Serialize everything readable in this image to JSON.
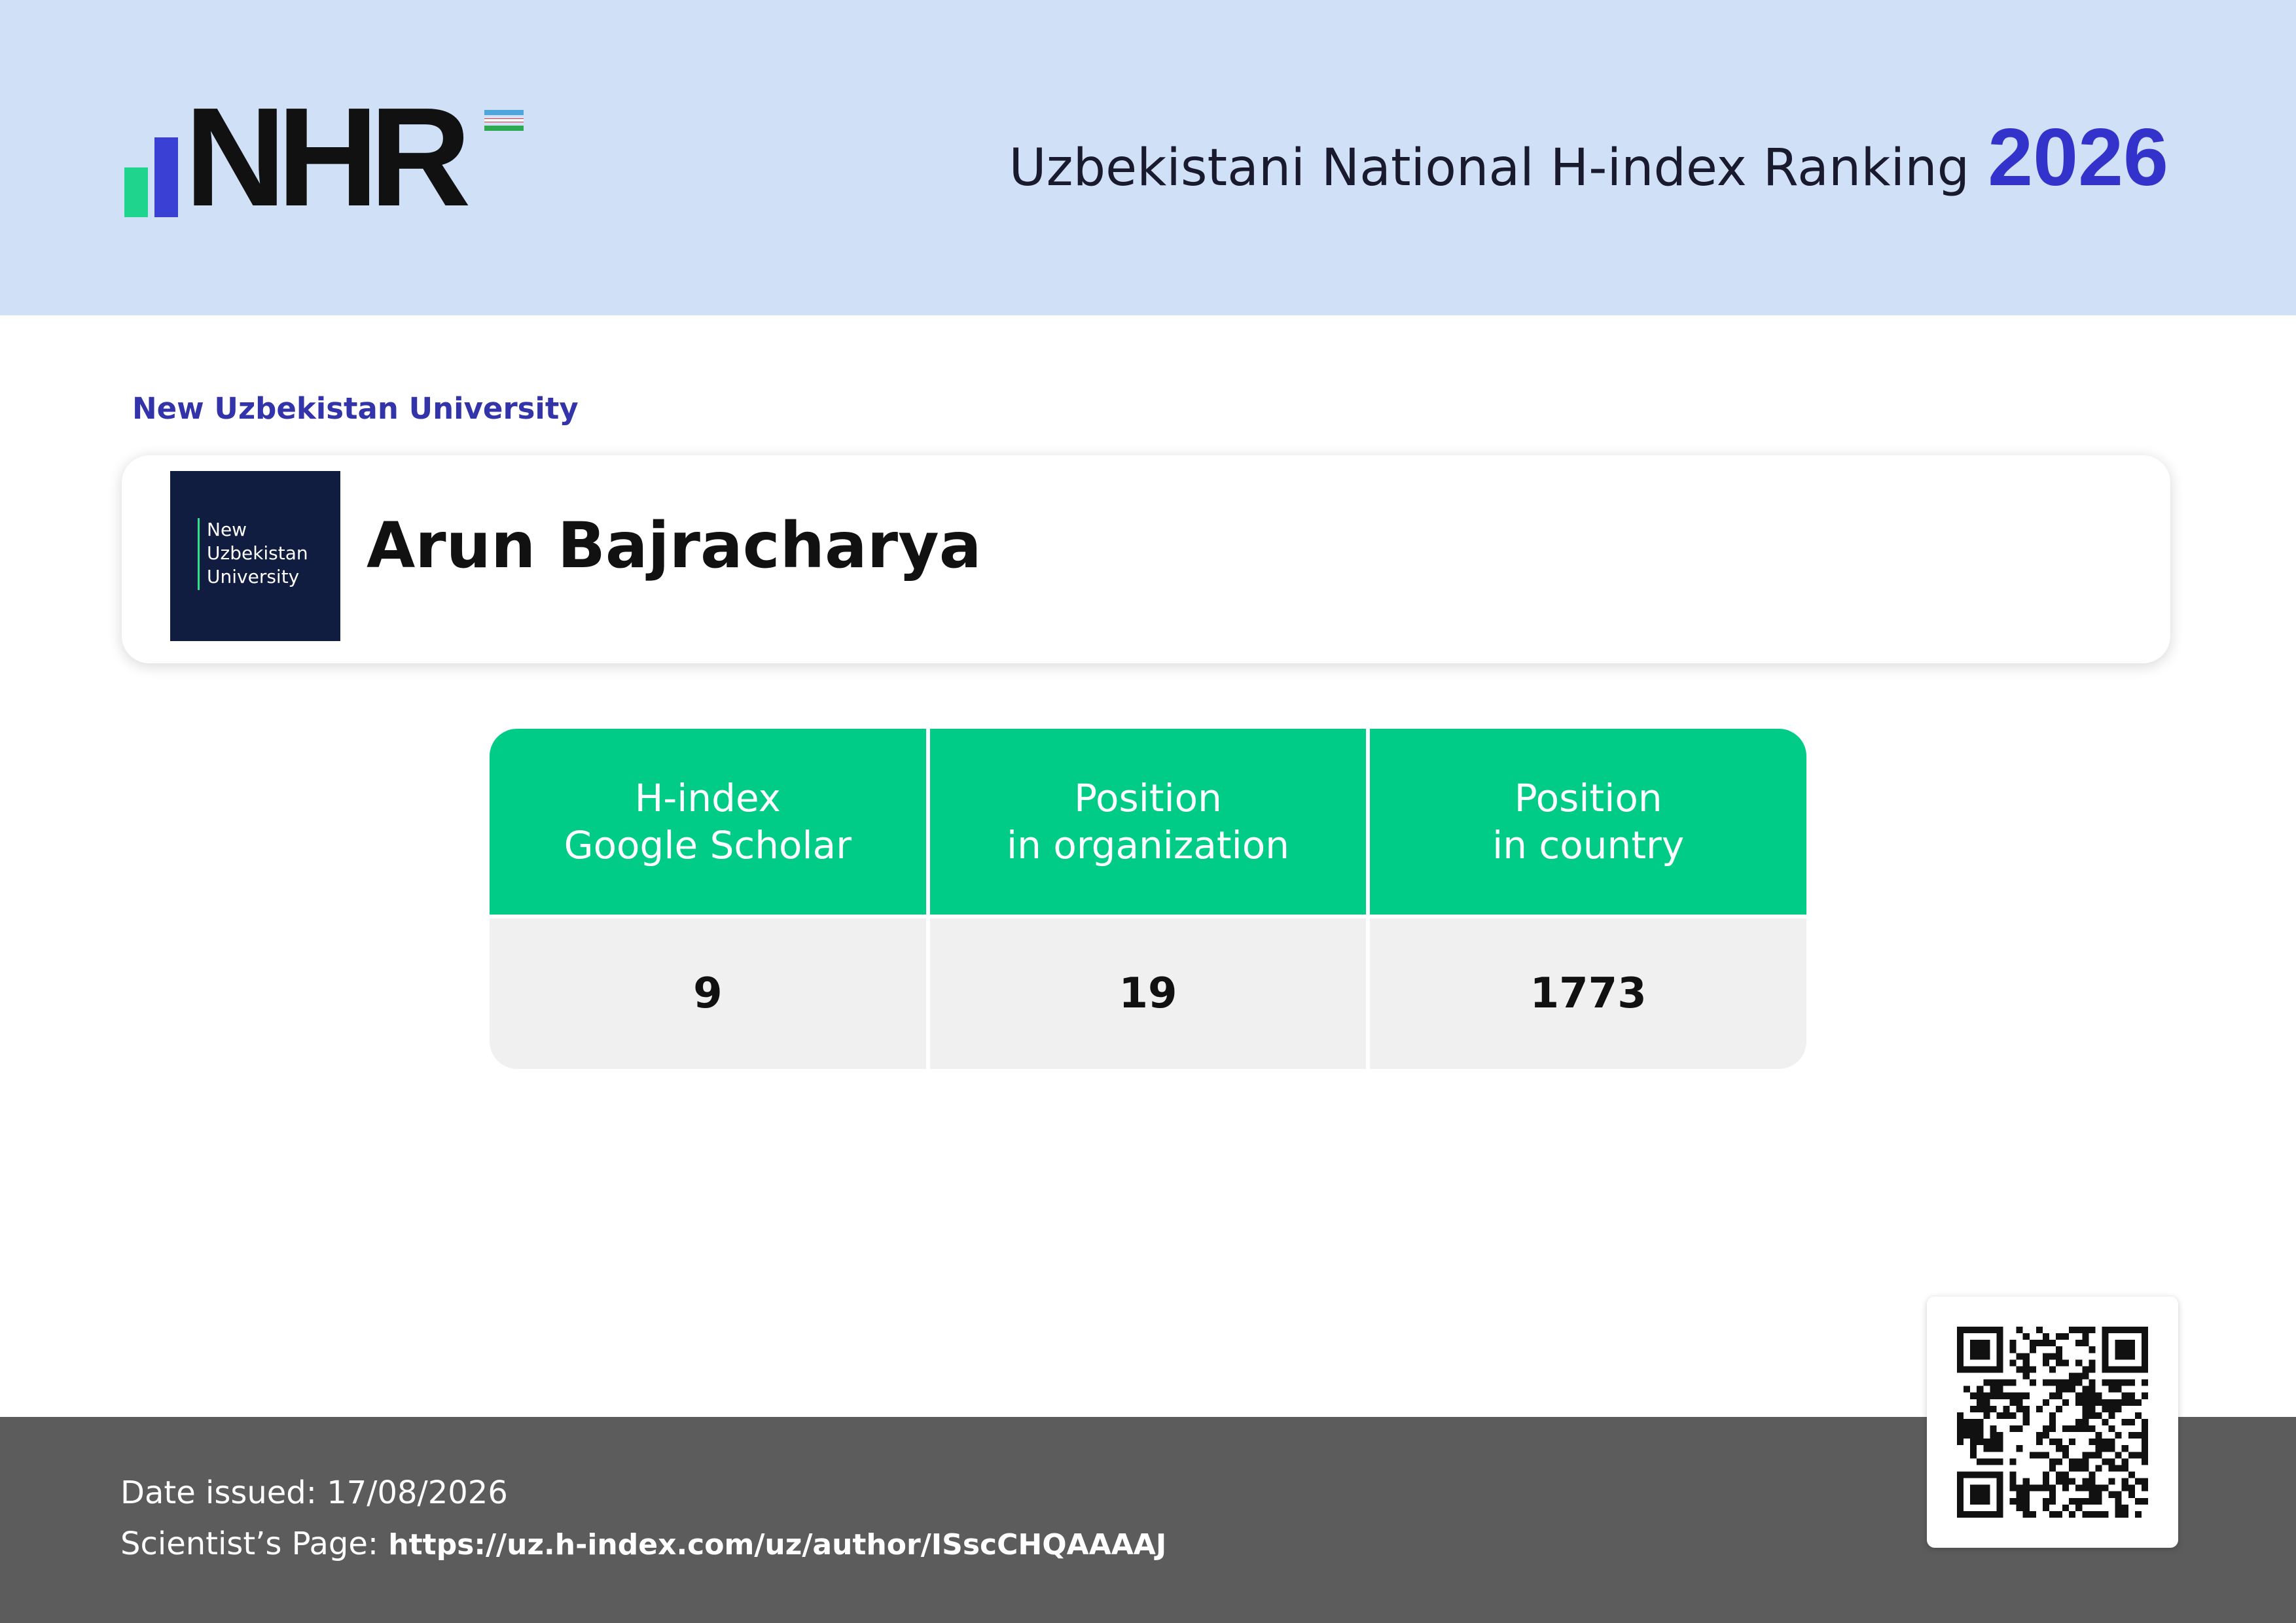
{
  "header": {
    "logo_text": "NHR",
    "title": "Uzbekistani National H-index Ranking",
    "year": "2026"
  },
  "organization": {
    "name": "New Uzbekistan University",
    "logo_lines": [
      "New",
      "Uzbekistan",
      "University"
    ]
  },
  "scientist": {
    "name": "Arun Bajracharya"
  },
  "stats": {
    "columns": [
      {
        "header_line1": "H-index",
        "header_line2": "Google Scholar",
        "value": "9"
      },
      {
        "header_line1": "Position",
        "header_line2": "in organization",
        "value": "19"
      },
      {
        "header_line1": "Position",
        "header_line2": "in country",
        "value": "1773"
      }
    ]
  },
  "footer": {
    "date_label": "Date issued:",
    "date_value": "17/08/2026",
    "page_label": "Scientist’s Page:",
    "page_url": "https://uz.h-index.com/uz/author/ISscCHQAAAAJ"
  },
  "colors": {
    "header_bg": "#cfe0f7",
    "accent_blue": "#3333cc",
    "accent_green": "#00cc88",
    "footer_bg": "#5c5c5c"
  },
  "icons": {
    "qr": "qr-code-icon",
    "flag": "uzbekistan-flag-icon"
  }
}
